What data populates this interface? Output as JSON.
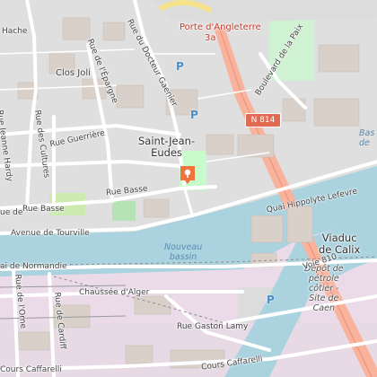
{
  "map": {
    "places": {
      "porte_dangleterre": "Porte d'Angleterre",
      "porte_number": "3a",
      "clos_joli": "Clos Joli",
      "saint_jean_eudes": "Saint-Jean-\nEudes",
      "viaduc_de_calix": "Viaduc\nde Calix",
      "nouveau_bassin": "Nouveau\nbassin",
      "depot": "Dépôt de\npétrole\ncôtier -\nSite de\nCaen",
      "bassin_partial": "Bas\nde"
    },
    "roads": {
      "hache": "Hache",
      "rue_du_docteur_gaenier": "Rue du Docteur Gaenier",
      "rue_de_lepargne": "Rue de l'Épargne",
      "boulevard_de_la_paix": "Boulevard de la Paix",
      "rue_guerriere": "Rue Guerrière",
      "rue_jeanne_hardy": "Rue Jeanne Hardy",
      "rue_des_cultures": "Rue des Cultures",
      "rue_basse": "Rue Basse",
      "rue_basse_2": "Rue Basse",
      "avenue_de_tourville": "Avenue de Tourville",
      "quai_hippolyte_lefevre": "Quai Hippolyte Lefevre",
      "voie_810": "Voie 810",
      "quai_de_normandie": "ai de Normandie",
      "rue_de_lorne": "Rue de l'Orne",
      "rue_de_cardiff": "Rue de Cardiff",
      "chaussee_dalger": "Chaussée d'Alger",
      "rue_gaston_lamy": "Rue Gaston Lamy",
      "cours_caffarelli_left": "Cours Caffarelli",
      "cours_caffarelli_right": "Cours Caffarelli",
      "n814": "N 814",
      "rue_de_left": "ue de"
    },
    "parking": "P",
    "colors": {
      "water": "#aad3df",
      "land": "#f2efe9",
      "residential": "#e0dfdf",
      "park": "#c8facc",
      "trunk": "#f9b29c",
      "industrial": "#ebdbe8",
      "building": "#d9d0c9"
    }
  }
}
